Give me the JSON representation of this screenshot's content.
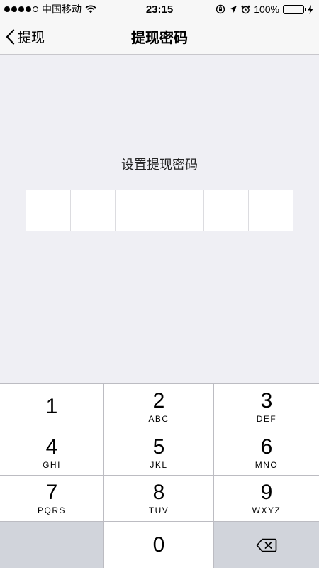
{
  "status_bar": {
    "carrier": "中国移动",
    "time": "23:15",
    "battery_percent": "100%",
    "battery_level": 1.0,
    "signal_bars": 5
  },
  "nav": {
    "back_label": "提现",
    "title": "提现密码"
  },
  "main": {
    "prompt": "设置提现密码",
    "pin_length": 6,
    "pin_cells": [
      "",
      "",
      "",
      "",
      "",
      ""
    ]
  },
  "keypad": {
    "keys": [
      {
        "digit": "1",
        "letters": ""
      },
      {
        "digit": "2",
        "letters": "ABC"
      },
      {
        "digit": "3",
        "letters": "DEF"
      },
      {
        "digit": "4",
        "letters": "GHI"
      },
      {
        "digit": "5",
        "letters": "JKL"
      },
      {
        "digit": "6",
        "letters": "MNO"
      },
      {
        "digit": "7",
        "letters": "PQRS"
      },
      {
        "digit": "8",
        "letters": "TUV"
      },
      {
        "digit": "9",
        "letters": "WXYZ"
      },
      {
        "digit": "0",
        "letters": ""
      }
    ]
  },
  "colors": {
    "background": "#efeff4",
    "battery_green": "#4cd964",
    "key_gray": "#d1d4db"
  }
}
